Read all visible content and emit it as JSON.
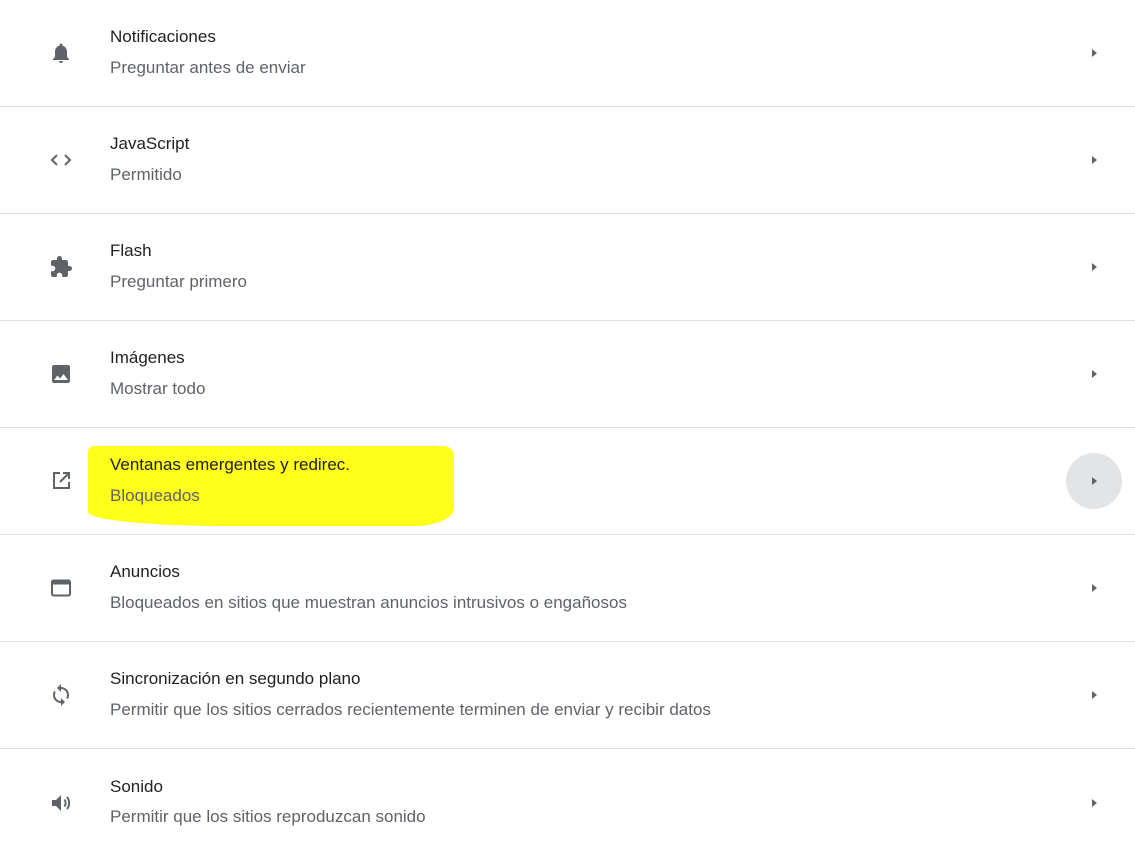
{
  "settings_list": {
    "items": [
      {
        "icon": "bell-icon",
        "title": "Notificaciones",
        "subtitle": "Preguntar antes de enviar"
      },
      {
        "icon": "code-icon",
        "title": "JavaScript",
        "subtitle": "Permitido"
      },
      {
        "icon": "puzzle-icon",
        "title": "Flash",
        "subtitle": "Preguntar primero"
      },
      {
        "icon": "image-icon",
        "title": "Imágenes",
        "subtitle": "Mostrar todo"
      },
      {
        "icon": "open-in-new-icon",
        "title": "Ventanas emergentes y redirec.",
        "subtitle": "Bloqueados",
        "highlighted": true,
        "hovered": true
      },
      {
        "icon": "web-asset-icon",
        "title": "Anuncios",
        "subtitle": "Bloqueados en sitios que muestran anuncios intrusivos o engañosos"
      },
      {
        "icon": "sync-icon",
        "title": "Sincronización en segundo plano",
        "subtitle": "Permitir que los sitios cerrados recientemente terminen de enviar y recibir datos"
      },
      {
        "icon": "volume-up-icon",
        "title": "Sonido",
        "subtitle": "Permitir que los sitios reproduzcan sonido"
      }
    ]
  },
  "colors": {
    "highlight": "#ffff19",
    "divider": "#e0e0e0",
    "icon": "#5f6368",
    "hover_circle": "#e3e4e6"
  }
}
